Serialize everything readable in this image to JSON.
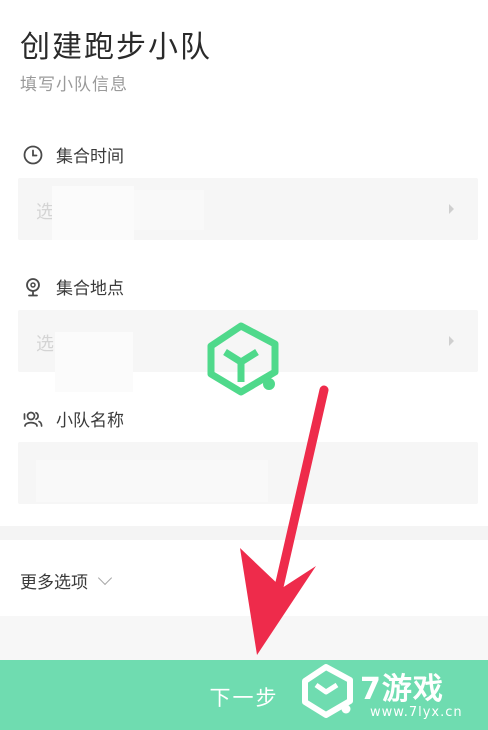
{
  "header": {
    "title": "创建跑步小队",
    "subtitle": "填写小队信息"
  },
  "form": {
    "meet_time": {
      "label": "集合时间",
      "icon": "clock-icon",
      "placeholder": "选"
    },
    "meet_place": {
      "label": "集合地点",
      "icon": "location-pin-icon",
      "placeholder": "选"
    },
    "team_name": {
      "label": "小队名称",
      "icon": "people-icon",
      "value": ""
    }
  },
  "more_options": {
    "label": "更多选项"
  },
  "footer": {
    "next_label": "下一步"
  },
  "watermark": {
    "site_name": "7游戏",
    "site_url": "www.7lyx.cn"
  },
  "colors": {
    "accent": "#6fdcb0",
    "watermark_green": "#4fd98b",
    "arrow_red": "#ee2b4b"
  }
}
